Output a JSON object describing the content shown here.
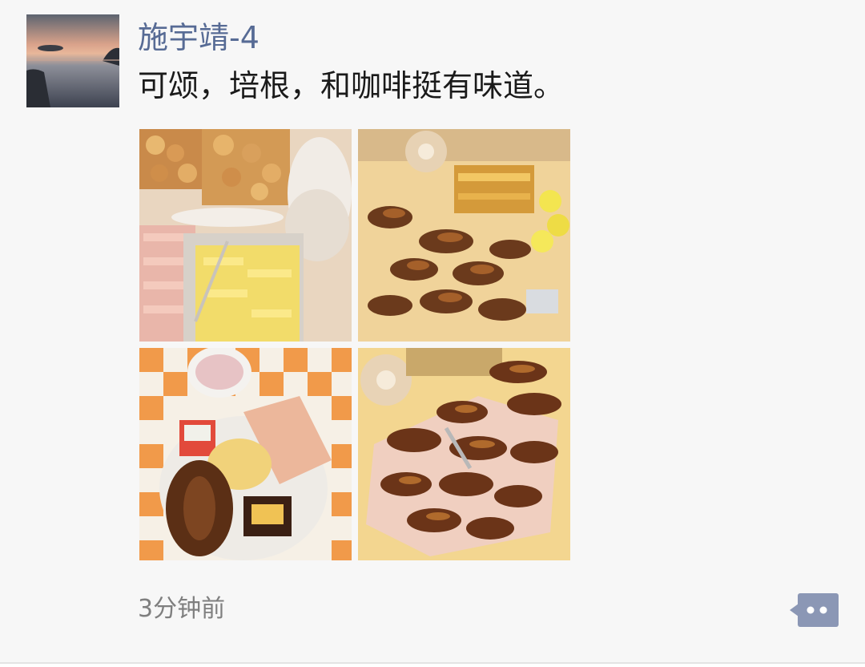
{
  "post": {
    "username": "施宇靖-4",
    "text": "可颂，培根，和咖啡挺有味道。",
    "time": "3分钟前",
    "photos": [
      {
        "icon": "bread-buffet-photo"
      },
      {
        "icon": "croissant-platter-photo"
      },
      {
        "icon": "breakfast-plate-photo"
      },
      {
        "icon": "croissant-tray-photo"
      }
    ],
    "avatar_icon": "sunset-lake-avatar",
    "more_icon": "comment-more-icon"
  },
  "colors": {
    "username": "#576b95",
    "text": "#1a1a1a",
    "time": "#7f7f7f",
    "more_button": "#8b97b5",
    "background": "#f7f7f7"
  }
}
